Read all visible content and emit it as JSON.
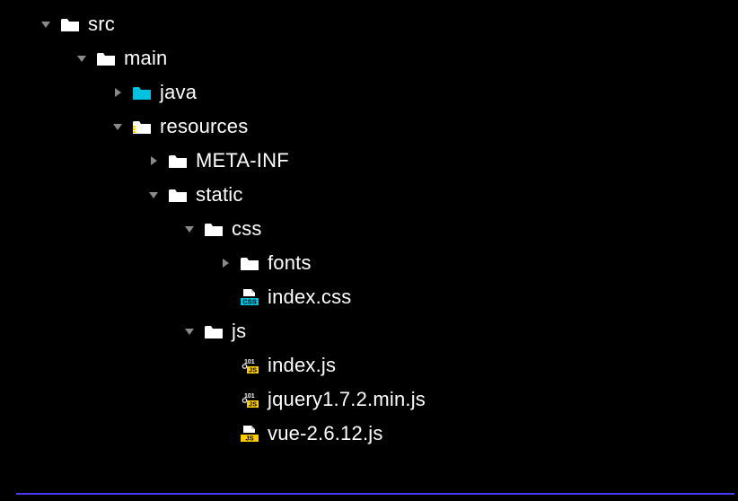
{
  "colors": {
    "bg": "#000000",
    "fg": "#ffffff",
    "chevron": "#8a8a8a",
    "folderFill": "#ffffff",
    "folderSource": "#00c2e0",
    "resourcesStripe": "#ffcc00",
    "cssBadge": "#00c2e0",
    "jsBadge": "#ffcc00",
    "underline": "#4a3bff"
  },
  "tree": [
    {
      "depth": 0,
      "arrow": "down",
      "iconType": "folder",
      "name": "src"
    },
    {
      "depth": 1,
      "arrow": "down",
      "iconType": "folder",
      "name": "main"
    },
    {
      "depth": 2,
      "arrow": "right",
      "iconType": "folder-source",
      "name": "java"
    },
    {
      "depth": 2,
      "arrow": "down",
      "iconType": "folder-res",
      "name": "resources"
    },
    {
      "depth": 3,
      "arrow": "right",
      "iconType": "folder",
      "name": "META-INF"
    },
    {
      "depth": 3,
      "arrow": "down",
      "iconType": "folder",
      "name": "static"
    },
    {
      "depth": 4,
      "arrow": "down",
      "iconType": "folder",
      "name": "css"
    },
    {
      "depth": 5,
      "arrow": "right",
      "iconType": "folder",
      "name": "fonts"
    },
    {
      "depth": 5,
      "arrow": "none",
      "iconType": "file-css",
      "name": "index.css"
    },
    {
      "depth": 4,
      "arrow": "down",
      "iconType": "folder",
      "name": "js"
    },
    {
      "depth": 5,
      "arrow": "none",
      "iconType": "file-js101",
      "name": "index.js"
    },
    {
      "depth": 5,
      "arrow": "none",
      "iconType": "file-js101",
      "name": "jquery1.7.2.min.js"
    },
    {
      "depth": 5,
      "arrow": "none",
      "iconType": "file-js",
      "name": "vue-2.6.12.js"
    }
  ]
}
